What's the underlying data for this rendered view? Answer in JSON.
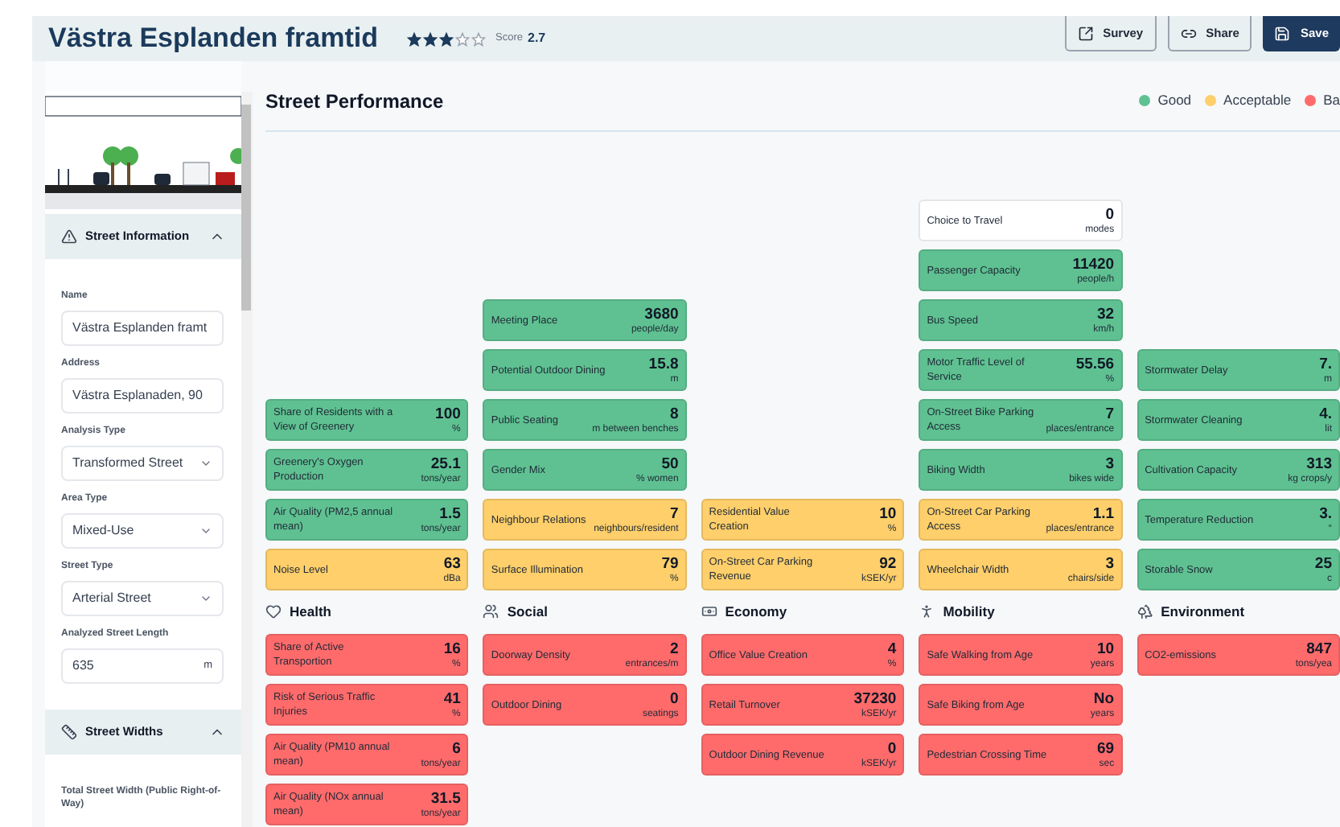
{
  "header": {
    "title": "Västra Esplanden framtid",
    "stars": 3,
    "score_label": "Score",
    "score": "2.7",
    "buttons": [
      {
        "label": "Survey",
        "kind": "survey"
      },
      {
        "label": "Share",
        "kind": "share"
      },
      {
        "label": "Save",
        "kind": "save"
      }
    ]
  },
  "sidebar": {
    "sections": [
      {
        "title": "Street Information",
        "kind": "info",
        "expanded": true,
        "fields": [
          {
            "label": "Name",
            "kind": "text",
            "value": "Västra Esplanden framt"
          },
          {
            "label": "Address",
            "kind": "text",
            "value": "Västra Esplanaden, 90"
          },
          {
            "label": "Analysis Type",
            "kind": "select",
            "value": "Transformed Street"
          },
          {
            "label": "Area Type",
            "kind": "select",
            "value": "Mixed-Use"
          },
          {
            "label": "Street Type",
            "kind": "select",
            "value": "Arterial Street"
          },
          {
            "label": "Analyzed Street Length",
            "kind": "number",
            "value": "635",
            "unit": "m"
          }
        ]
      },
      {
        "title": "Street Widths",
        "kind": "widths",
        "expanded": true,
        "fields": [
          {
            "label": "Total Street Width (Public Right-of-Way)",
            "kind": "caption"
          }
        ]
      }
    ]
  },
  "performance": {
    "title": "Street Performance",
    "legend": [
      {
        "label": "Good",
        "color": "#5fc191"
      },
      {
        "label": "Acceptable",
        "color": "#fecf6a"
      },
      {
        "label": "Ba",
        "color": "#ff6b6b"
      }
    ],
    "categories": [
      {
        "name": "Health",
        "kind": "health",
        "upper": [
          {
            "label": "Share of Residents with a View of Greenery",
            "value": "100",
            "unit": "%",
            "color": "#5fc191"
          },
          {
            "label": "Greenery's Oxygen Production",
            "value": "25.1",
            "unit": "tons/year",
            "color": "#5fc191"
          },
          {
            "label": "Air Quality (PM2,5 annual mean)",
            "value": "1.5",
            "unit": "tons/year",
            "color": "#5fc191"
          },
          {
            "label": "Noise Level",
            "value": "63",
            "unit": "dBa",
            "color": "#fecf6a"
          }
        ],
        "lower": [
          {
            "label": "Share of Active Transportion",
            "value": "16",
            "unit": "%",
            "color": "#ff6b6b"
          },
          {
            "label": "Risk of Serious Traffic Injuries",
            "value": "41",
            "unit": "%",
            "color": "#ff6b6b"
          },
          {
            "label": "Air Quality (PM10 annual mean)",
            "value": "6",
            "unit": "tons/year",
            "color": "#ff6b6b"
          },
          {
            "label": "Air Quality (NOx annual mean)",
            "value": "31.5",
            "unit": "tons/year",
            "color": "#ff6b6b"
          }
        ]
      },
      {
        "name": "Social",
        "kind": "social",
        "upper": [
          {
            "label": "Meeting Place",
            "value": "3680",
            "unit": "people/day",
            "color": "#5fc191"
          },
          {
            "label": "Potential Outdoor Dining",
            "value": "15.8",
            "unit": "m",
            "color": "#5fc191"
          },
          {
            "label": "Public Seating",
            "value": "8",
            "unit": "m between benches",
            "color": "#5fc191"
          },
          {
            "label": "Gender Mix",
            "value": "50",
            "unit": "% women",
            "color": "#5fc191"
          },
          {
            "label": "Neighbour Relations",
            "value": "7",
            "unit": "neighbours/resident",
            "color": "#fecf6a"
          },
          {
            "label": "Surface Illumination",
            "value": "79",
            "unit": "%",
            "color": "#fecf6a"
          }
        ],
        "lower": [
          {
            "label": "Doorway Density",
            "value": "2",
            "unit": "entrances/m",
            "color": "#ff6b6b"
          },
          {
            "label": "Outdoor Dining",
            "value": "0",
            "unit": "seatings",
            "color": "#ff6b6b"
          }
        ]
      },
      {
        "name": "Economy",
        "kind": "economy",
        "upper": [
          {
            "label": "Residential Value Creation",
            "value": "10",
            "unit": "%",
            "color": "#fecf6a"
          },
          {
            "label": "On-Street Car Parking Revenue",
            "value": "92",
            "unit": "kSEK/yr",
            "color": "#fecf6a"
          }
        ],
        "lower": [
          {
            "label": "Office Value Creation",
            "value": "4",
            "unit": "%",
            "color": "#ff6b6b"
          },
          {
            "label": "Retail Turnover",
            "value": "37230",
            "unit": "kSEK/yr",
            "color": "#ff6b6b"
          },
          {
            "label": "Outdoor Dining Revenue",
            "value": "0",
            "unit": "kSEK/yr",
            "color": "#ff6b6b"
          }
        ]
      },
      {
        "name": "Mobility",
        "kind": "mobility",
        "upper": [
          {
            "label": "Choice to Travel",
            "value": "0",
            "unit": "modes",
            "color": "#ffffff"
          },
          {
            "label": "Passenger Capacity",
            "value": "11420",
            "unit": "people/h",
            "color": "#5fc191"
          },
          {
            "label": "Bus Speed",
            "value": "32",
            "unit": "km/h",
            "color": "#5fc191"
          },
          {
            "label": "Motor Traffic Level of Service",
            "value": "55.56",
            "unit": "%",
            "color": "#5fc191"
          },
          {
            "label": "On-Street Bike Parking Access",
            "value": "7",
            "unit": "places/entrance",
            "color": "#5fc191"
          },
          {
            "label": "Biking Width",
            "value": "3",
            "unit": "bikes wide",
            "color": "#5fc191"
          },
          {
            "label": "On-Street Car Parking Access",
            "value": "1.1",
            "unit": "places/entrance",
            "color": "#fecf6a"
          },
          {
            "label": "Wheelchair Width",
            "value": "3",
            "unit": "chairs/side",
            "color": "#fecf6a"
          }
        ],
        "lower": [
          {
            "label": "Safe Walking from Age",
            "value": "10",
            "unit": "years",
            "color": "#ff6b6b"
          },
          {
            "label": "Safe Biking from Age",
            "value": "No",
            "unit": "years",
            "color": "#ff6b6b"
          },
          {
            "label": "Pedestrian Crossing Time",
            "value": "69",
            "unit": "sec",
            "color": "#ff6b6b"
          }
        ]
      },
      {
        "name": "Environment",
        "kind": "environment",
        "upper": [
          {
            "label": "Stormwater Delay",
            "value": "7.",
            "unit": "m",
            "color": "#5fc191"
          },
          {
            "label": "Stormwater Cleaning",
            "value": "4.",
            "unit": "lit",
            "color": "#5fc191"
          },
          {
            "label": "Cultivation Capacity",
            "value": "313",
            "unit": "kg crops/y",
            "color": "#5fc191"
          },
          {
            "label": "Temperature Reduction",
            "value": "3.",
            "unit": "°",
            "color": "#5fc191"
          },
          {
            "label": "Storable Snow",
            "value": "25",
            "unit": "c",
            "color": "#5fc191"
          }
        ],
        "lower": [
          {
            "label": "CO2-emissions",
            "value": "847",
            "unit": "tons/yea",
            "color": "#ff6b6b"
          }
        ]
      }
    ]
  }
}
